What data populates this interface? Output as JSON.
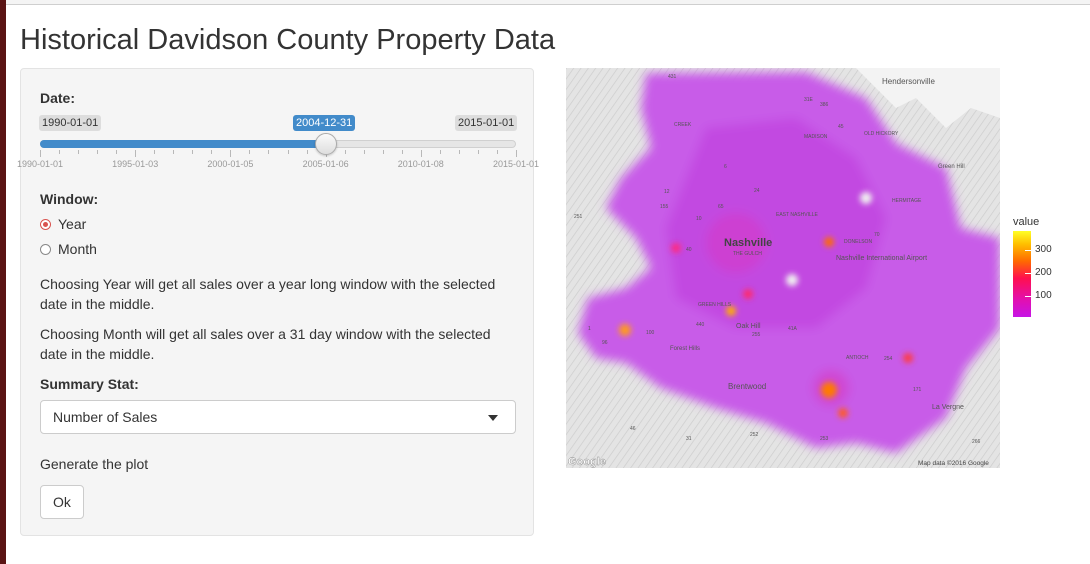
{
  "page": {
    "title": "Historical Davidson County Property Data"
  },
  "sidebar": {
    "date": {
      "label": "Date:",
      "min_label": "1990-01-01",
      "max_label": "2015-01-01",
      "selected_label": "2004-12-31",
      "selected_fraction": 0.6,
      "tick_labels": [
        "1990-01-01",
        "1995-01-03",
        "2000-01-05",
        "2005-01-06",
        "2010-01-08",
        "2015-01-01"
      ]
    },
    "window": {
      "label": "Window:",
      "options": [
        {
          "label": "Year",
          "selected": true
        },
        {
          "label": "Month",
          "selected": false
        }
      ],
      "help_year": "Choosing Year will get all sales over a year long window with the selected date in the middle.",
      "help_month": "Choosing Month will get all sales over a 31 day window with the selected date in the middle."
    },
    "summary": {
      "label": "Summary Stat:",
      "selected": "Number of Sales"
    },
    "generate": {
      "label": "Generate the plot",
      "button": "Ok"
    }
  },
  "map": {
    "places": [
      "Hendersonville",
      "Nashville",
      "THE GULCH",
      "EAST NASHVILLE",
      "DONELSON",
      "Nashville International Airport",
      "Green Hill",
      "HERMITAGE",
      "MADISON",
      "OLD HICKORY",
      "GREEN HILLS",
      "Oak Hill",
      "Forest Hills",
      "Brentwood",
      "ANTIOCH",
      "La Vergne",
      "CREEK"
    ],
    "roads": [
      "431",
      "386",
      "31E",
      "45",
      "155",
      "24",
      "40",
      "65",
      "70",
      "100",
      "440",
      "41A",
      "255",
      "254",
      "171",
      "266",
      "253",
      "252",
      "46",
      "96",
      "1",
      "251",
      "10",
      "12",
      "6",
      "31"
    ],
    "attribution_logo": "Google",
    "attribution": "Map data ©2016 Google"
  },
  "legend": {
    "title": "value",
    "ticks": [
      300,
      200,
      100
    ],
    "colors": [
      "#ffff26",
      "#ffc000",
      "#ff6a00",
      "#ff0f4f",
      "#e20fb0",
      "#c614e6"
    ]
  }
}
